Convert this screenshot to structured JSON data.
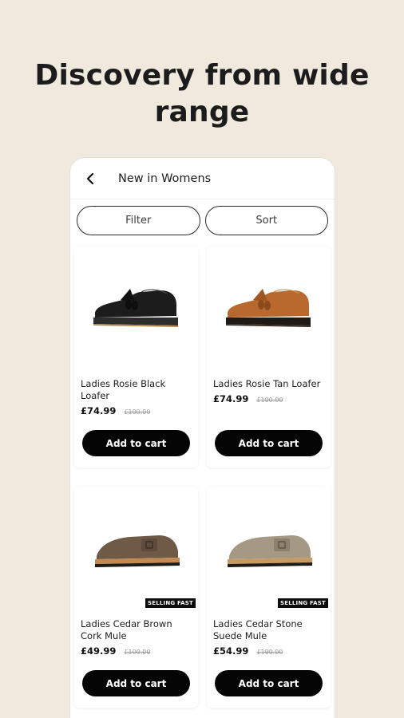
{
  "headline": "Discovery from wide range",
  "header": {
    "title": "New in Womens",
    "back_icon": "chevron-left-icon"
  },
  "controls": {
    "filter_label": "Filter",
    "sort_label": "Sort"
  },
  "products": [
    {
      "name": "Ladies Rosie Black Loafer",
      "price": "£74.99",
      "was": "£100.00",
      "cta": "Add to cart",
      "badge": "",
      "image": "black-loafer",
      "color": "#1c1c1c"
    },
    {
      "name": "Ladies Rosie Tan Loafer",
      "price": "£74.99",
      "was": "£100.00",
      "cta": "Add to cart",
      "badge": "",
      "image": "tan-loafer",
      "color": "#b9692d"
    },
    {
      "name": "Ladies Cedar Brown Cork Mule",
      "price": "£49.99",
      "was": "£100.00",
      "cta": "Add to cart",
      "badge": "SELLING FAST",
      "image": "brown-mule",
      "color": "#6f5a48"
    },
    {
      "name": "Ladies Cedar Stone Suede Mule",
      "price": "£54.99",
      "was": "£100.00",
      "cta": "Add to cart",
      "badge": "SELLING FAST",
      "image": "stone-mule",
      "color": "#a59985"
    }
  ],
  "colors": {
    "background": "#efe9de",
    "button": "#050505",
    "card": "#ffffff"
  }
}
